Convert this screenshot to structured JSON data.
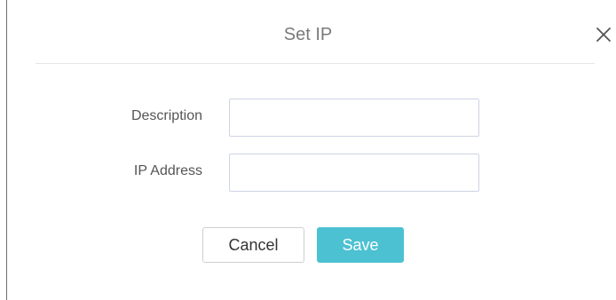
{
  "dialog": {
    "title": "Set IP",
    "close_icon": "close-icon"
  },
  "form": {
    "description": {
      "label": "Description",
      "value": "",
      "placeholder": ""
    },
    "ip_address": {
      "label": "IP Address",
      "value": "",
      "placeholder": ""
    }
  },
  "buttons": {
    "cancel_label": "Cancel",
    "save_label": "Save"
  },
  "colors": {
    "accent": "#4bc1d2",
    "title_text": "#7a7a7a",
    "label_text": "#555555",
    "input_border": "#cfd3e6"
  }
}
